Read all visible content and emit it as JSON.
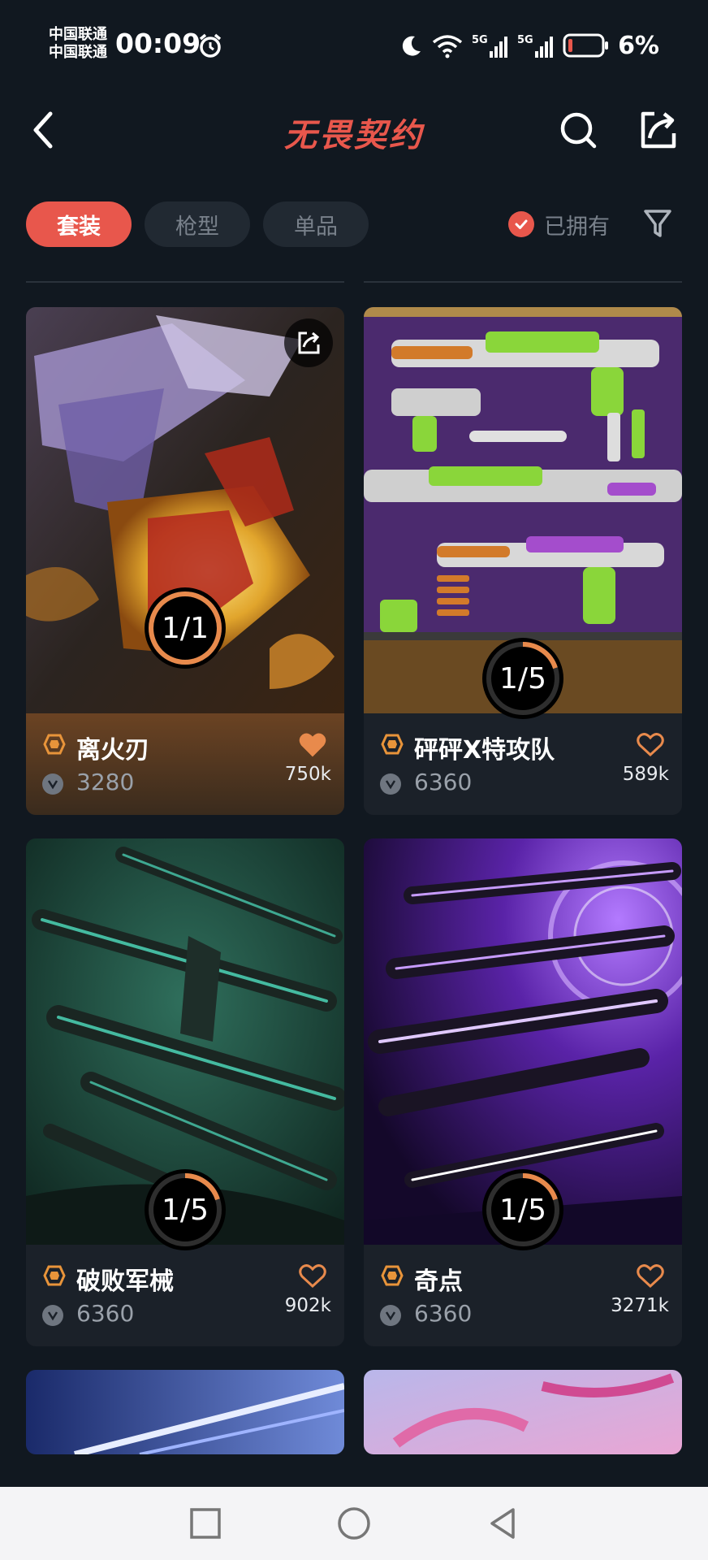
{
  "status_bar": {
    "carrier_1": "中国联通",
    "carrier_2": "中国联通",
    "time": "00:09",
    "battery": "6%"
  },
  "header": {
    "title": "无畏契约"
  },
  "tabs": [
    {
      "label": "套装",
      "active": true
    },
    {
      "label": "枪型",
      "active": false
    },
    {
      "label": "单品",
      "active": false
    }
  ],
  "filters": {
    "owned_label": "已拥有"
  },
  "cards": [
    {
      "name": "离火刃",
      "price": "3280",
      "likes": "750k",
      "progress": "1/1",
      "progress_fraction": 1.0,
      "favorited": true,
      "featured": true
    },
    {
      "name": "砰砰X特攻队",
      "price": "6360",
      "likes": "589k",
      "progress": "1/5",
      "progress_fraction": 0.2,
      "favorited": false,
      "featured": false
    },
    {
      "name": "破败军械",
      "price": "6360",
      "likes": "902k",
      "progress": "1/5",
      "progress_fraction": 0.2,
      "favorited": false,
      "featured": false
    },
    {
      "name": "奇点",
      "price": "6360",
      "likes": "3271k",
      "progress": "1/5",
      "progress_fraction": 0.2,
      "favorited": false,
      "featured": false
    }
  ],
  "colors": {
    "accent": "#e8574c",
    "progress": "#e88a4c",
    "background": "#111820"
  }
}
